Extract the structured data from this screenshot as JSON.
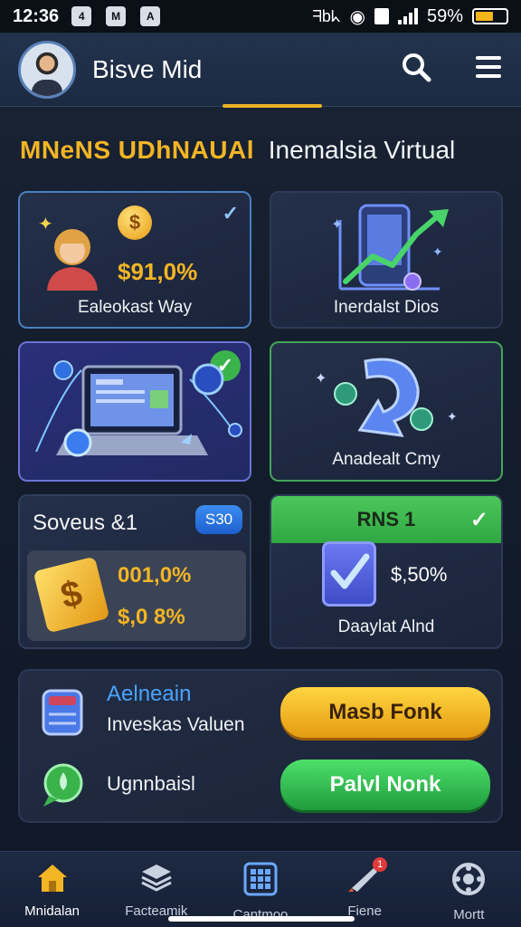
{
  "status_bar": {
    "time": "12:36",
    "notif_icons": [
      "4",
      "M",
      "A"
    ],
    "battery": "59%",
    "battery_level": 0.59,
    "carrier_text": "ᖷbᖾ"
  },
  "header": {
    "username": "Bisve Mid"
  },
  "section_title": {
    "highlight": "MNeNS UDhNAUAl",
    "rest": "Inemalsia Virtual"
  },
  "cards": {
    "card1": {
      "value": "$91,0%",
      "label": "Ealeokast Way"
    },
    "card2": {
      "label": "Inerdalst Dios"
    },
    "card3": {},
    "card4": {
      "label": "Anadealt Cmy"
    },
    "card5": {
      "title": "Soveus &1",
      "badge": "S30",
      "value1": "001,0%",
      "value2": "$,0 8%"
    },
    "card6": {
      "header": "RNS 1",
      "value": "$,50%",
      "label": "Daaylat Alnd"
    }
  },
  "panel": {
    "row1_title": "Aelneain",
    "row1_sub": "Inveskas Valuen",
    "row1_button": "Masb Fonk",
    "row2_title": "Ugnnbaisl",
    "row2_button": "Palvl Nonk"
  },
  "bottom_nav": [
    {
      "label": "Mnidalan",
      "icon": "home-icon"
    },
    {
      "label": "Facteamik",
      "icon": "stack-icon"
    },
    {
      "label": "Cantmoo",
      "icon": "calculator-icon"
    },
    {
      "label": "Fiene",
      "icon": "rocket-icon",
      "badge": "1"
    },
    {
      "label": "Mortt",
      "icon": "settings-icon"
    }
  ],
  "colors": {
    "accent_yellow": "#f3b524",
    "accent_green": "#3bb34b",
    "accent_blue": "#3b8df0",
    "background": "#141d2c"
  }
}
